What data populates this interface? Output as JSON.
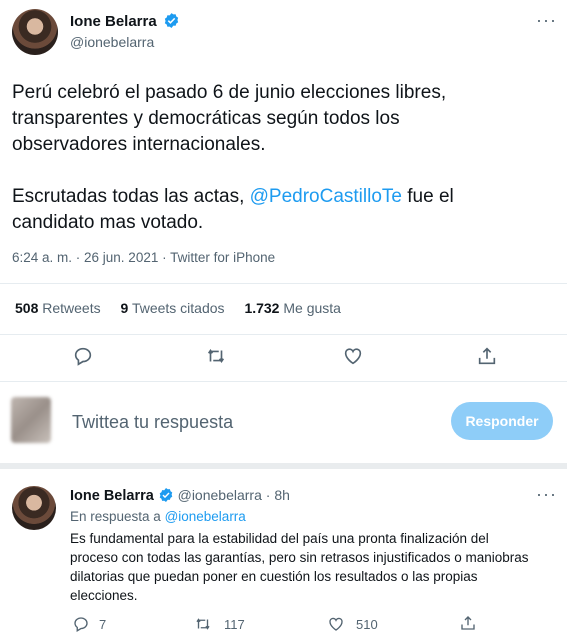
{
  "tweet": {
    "author_name": "Ione Belarra",
    "author_handle": "@ionebelarra",
    "more_label": "···",
    "text_line1": "Perú celebró el pasado 6 de junio elecciones libres,",
    "text_line2": "transparentes y democráticas según todos los",
    "text_line3": "observadores internacionales.",
    "text_line4_pre": "Escrutadas todas las actas, ",
    "text_line4_mention": "@PedroCastilloTe",
    "text_line4_post": " fue el",
    "text_line5": "candidato mas votado.",
    "timestamp": "6:24 a. m. · 26 jun. 2021 · Twitter for iPhone",
    "stats": {
      "retweets_count": "508",
      "retweets_label": "Retweets",
      "quotes_count": "9",
      "quotes_label": "Tweets citados",
      "likes_count": "1.732",
      "likes_label": "Me gusta"
    }
  },
  "composer": {
    "placeholder": "Twittea tu respuesta",
    "reply_button": "Responder"
  },
  "reply": {
    "author_name": "Ione Belarra",
    "author_handle": "@ionebelarra",
    "time": "· 8h",
    "more_label": "···",
    "in_reply_prefix": "En respuesta a ",
    "in_reply_handle": "@ionebelarra",
    "text_line1": "Es fundamental para la estabilidad del país una pronta finalización del",
    "text_line2": "proceso con todas las garantías, pero sin retrasos injustificados o maniobras",
    "text_line3": "dilatorias que puedan poner en cuestión los resultados o las propias",
    "text_line4": "elecciones.",
    "reply_count": "7",
    "retweet_count": "117",
    "like_count": "510"
  },
  "colors": {
    "link": "#1d9bf0",
    "verified": "#1d9bf0",
    "reply_button_bg": "#8ecdf8"
  },
  "icons": [
    "verified-badge-icon",
    "more-icon",
    "reply-icon",
    "retweet-icon",
    "like-icon",
    "share-icon"
  ]
}
